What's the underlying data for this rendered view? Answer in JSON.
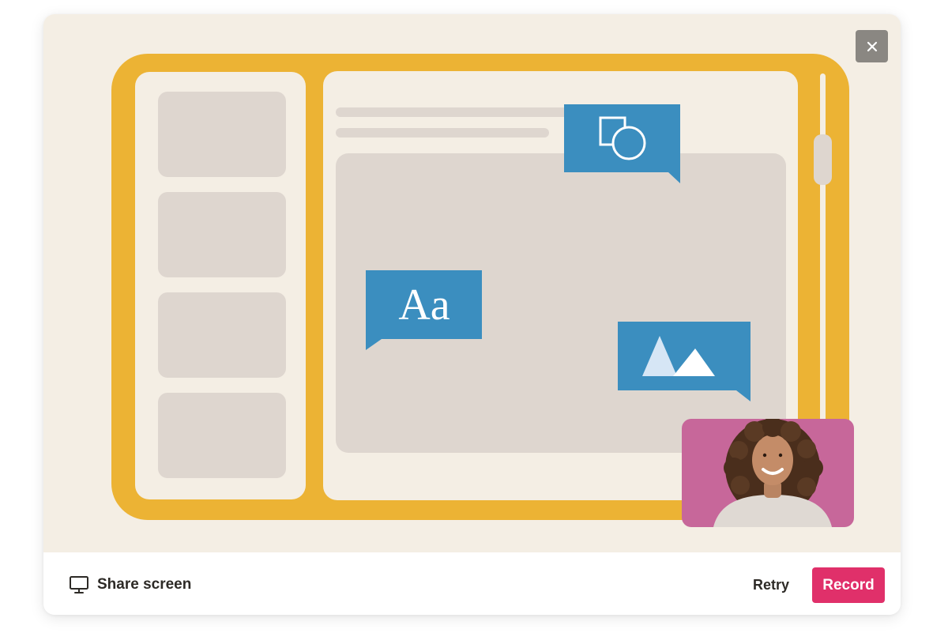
{
  "footer": {
    "share_label": "Share screen",
    "retry_label": "Retry",
    "record_label": "Record"
  },
  "illustration": {
    "text_bubble_label": "Aa",
    "icons": {
      "shapes": "shapes-icon",
      "text": "text-icon",
      "image": "image-icon",
      "monitor": "monitor-icon",
      "close": "close-icon"
    }
  },
  "colors": {
    "stage_bg": "#f4eee4",
    "frame_yellow": "#ecb334",
    "placeholder_gray": "#ded6cf",
    "bubble_blue": "#3b8ebf",
    "webcam_pink": "#c7679a",
    "record_pink": "#e0306a",
    "close_gray": "#8a8782"
  }
}
